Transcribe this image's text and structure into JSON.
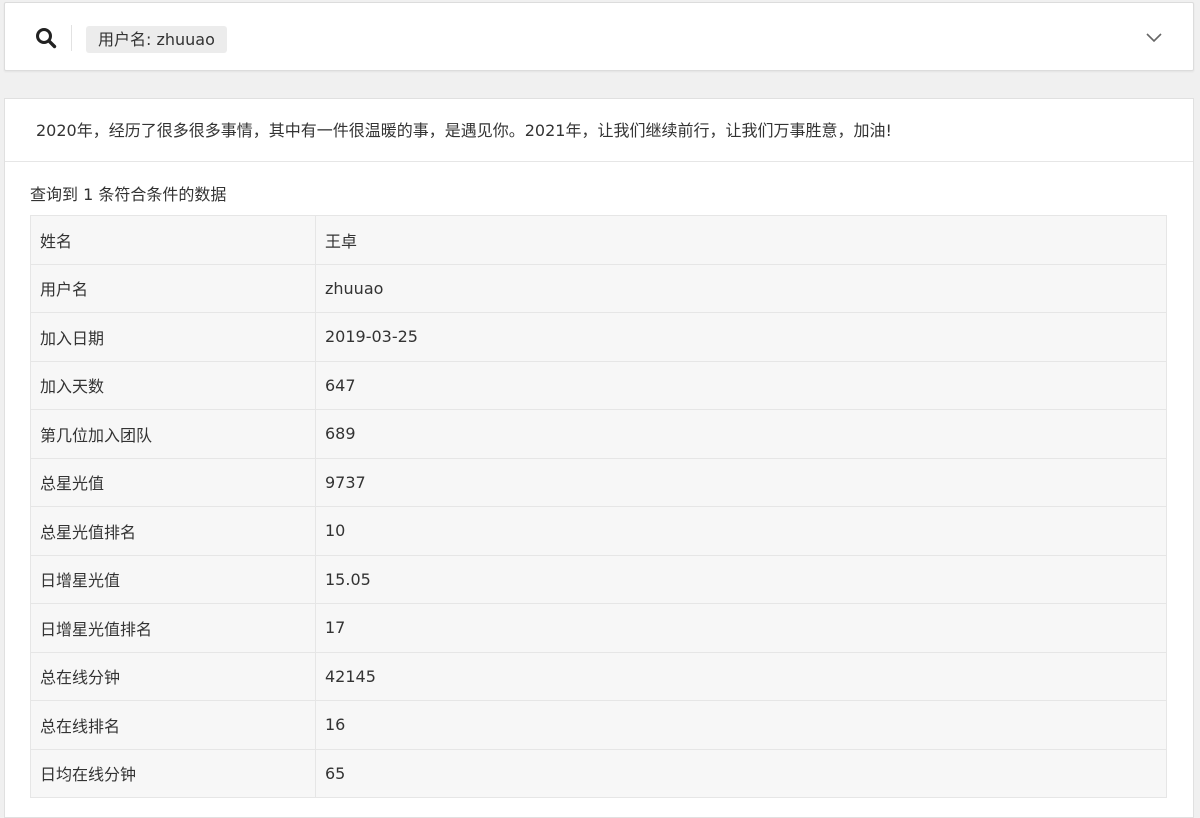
{
  "search": {
    "filter_tag": "用户名: zhuuao"
  },
  "announcement": "2020年，经历了很多很多事情，其中有一件很温暖的事，是遇见你。2021年，让我们继续前行，让我们万事胜意，加油!",
  "result_count": "查询到 1 条符合条件的数据",
  "rows": [
    {
      "label": "姓名",
      "value": "王卓"
    },
    {
      "label": "用户名",
      "value": "zhuuao"
    },
    {
      "label": "加入日期",
      "value": "2019-03-25"
    },
    {
      "label": "加入天数",
      "value": "647"
    },
    {
      "label": "第几位加入团队",
      "value": "689"
    },
    {
      "label": "总星光值",
      "value": "9737"
    },
    {
      "label": "总星光值排名",
      "value": "10"
    },
    {
      "label": "日增星光值",
      "value": "15.05"
    },
    {
      "label": "日增星光值排名",
      "value": "17"
    },
    {
      "label": "总在线分钟",
      "value": "42145"
    },
    {
      "label": "总在线排名",
      "value": "16"
    },
    {
      "label": "日均在线分钟",
      "value": "65"
    }
  ]
}
